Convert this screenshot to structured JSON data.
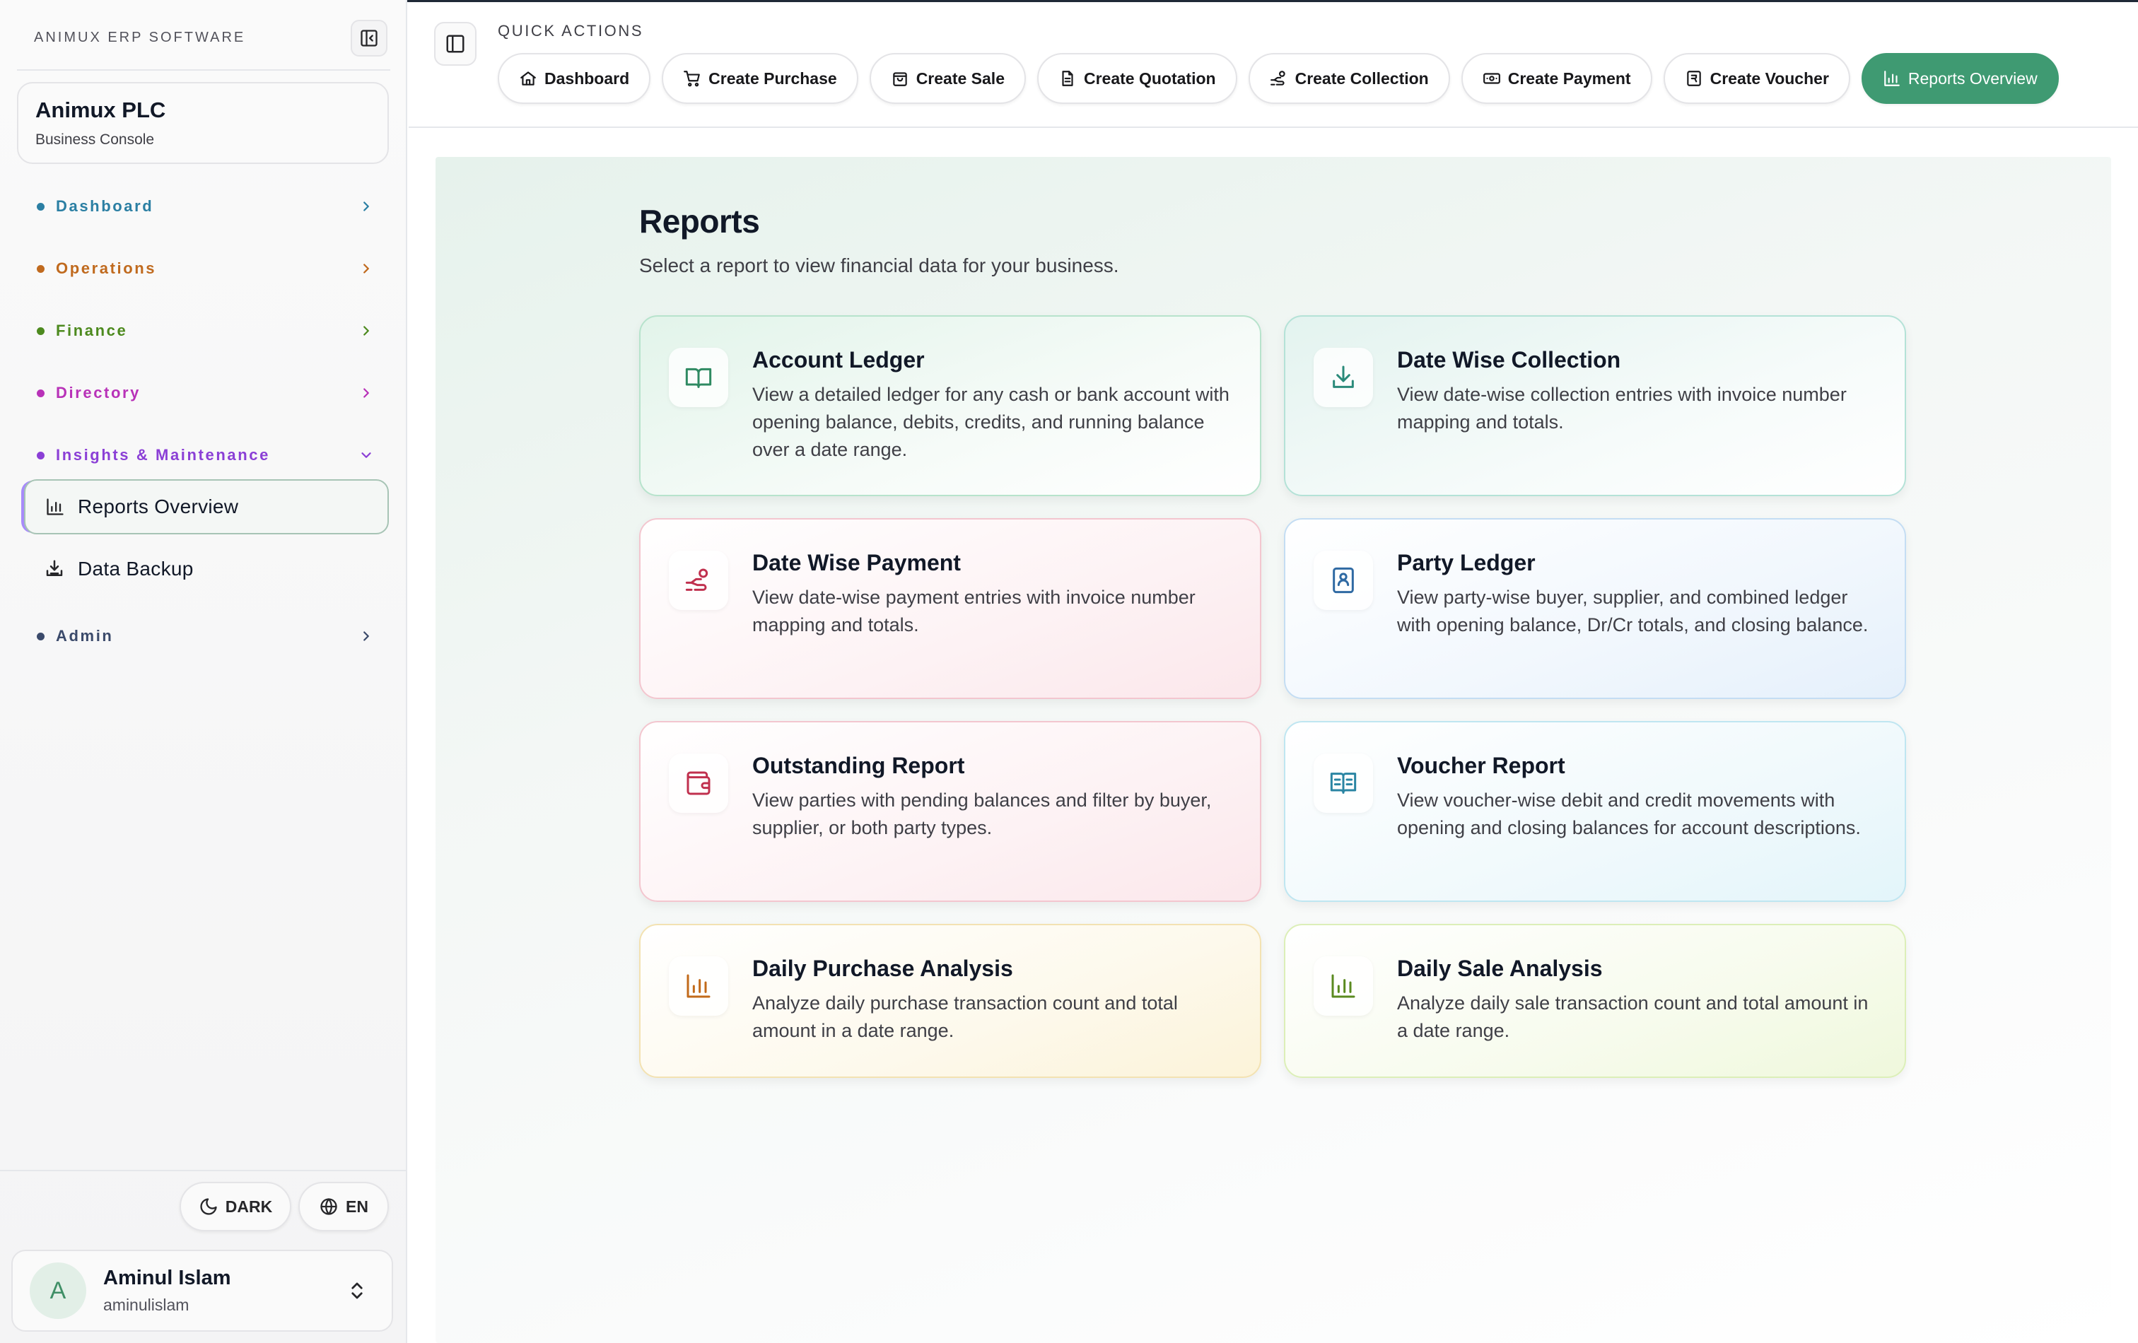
{
  "app": {
    "brand": "ANIMUX ERP SOFTWARE",
    "org_name": "Animux PLC",
    "org_sub": "Business Console"
  },
  "sidebar": {
    "groups": [
      {
        "label": "Dashboard",
        "color": "#2b7fa3"
      },
      {
        "label": "Operations",
        "color": "#c06a1e"
      },
      {
        "label": "Finance",
        "color": "#4d8a1f"
      },
      {
        "label": "Directory",
        "color": "#b832b8"
      },
      {
        "label": "Insights & Maintenance",
        "color": "#8b3fd6"
      },
      {
        "label": "Admin",
        "color": "#3b4a6b"
      }
    ],
    "sub_items": [
      {
        "label": "Reports Overview",
        "icon": "bar-chart-icon",
        "active": true
      },
      {
        "label": "Data Backup",
        "icon": "download-tray-icon",
        "active": false
      }
    ],
    "theme_label": "DARK",
    "lang_label": "EN",
    "user": {
      "initial": "A",
      "name": "Aminul Islam",
      "handle": "aminulislam"
    }
  },
  "topbar": {
    "quick_actions_label": "QUICK ACTIONS",
    "actions": [
      {
        "label": "Dashboard",
        "icon": "home-icon"
      },
      {
        "label": "Create Purchase",
        "icon": "cart-icon"
      },
      {
        "label": "Create Sale",
        "icon": "bag-icon"
      },
      {
        "label": "Create Quotation",
        "icon": "document-icon"
      },
      {
        "label": "Create Collection",
        "icon": "hand-coins-icon"
      },
      {
        "label": "Create Payment",
        "icon": "banknote-icon"
      },
      {
        "label": "Create Voucher",
        "icon": "voucher-icon"
      },
      {
        "label": "Reports Overview",
        "icon": "bar-chart-icon",
        "active": true
      }
    ],
    "accent": "#3f9a72"
  },
  "main": {
    "title": "Reports",
    "subtitle": "Select a report to view financial data for your business.",
    "cards": [
      {
        "title": "Account Ledger",
        "desc": "View a detailed ledger for any cash or bank account with opening balance, debits, credits, and running balance over a date range.",
        "icon": "book-open-icon",
        "color": "#2f8a62"
      },
      {
        "title": "Date Wise Collection",
        "desc": "View date-wise collection entries with invoice number mapping and totals.",
        "icon": "download-tray-icon",
        "color": "#2a8a7a"
      },
      {
        "title": "Date Wise Payment",
        "desc": "View date-wise payment entries with invoice number mapping and totals.",
        "icon": "hand-coins-icon",
        "color": "#c0304e"
      },
      {
        "title": "Party Ledger",
        "desc": "View party-wise buyer, supplier, and combined ledger with opening balance, Dr/Cr totals, and closing balance.",
        "icon": "contact-book-icon",
        "color": "#2f6aa3"
      },
      {
        "title": "Outstanding Report",
        "desc": "View parties with pending balances and filter by buyer, supplier, or both party types.",
        "icon": "wallet-icon",
        "color": "#c0304e"
      },
      {
        "title": "Voucher Report",
        "desc": "View voucher-wise debit and credit movements with opening and closing balances for account descriptions.",
        "icon": "book-columns-icon",
        "color": "#2a85a3"
      },
      {
        "title": "Daily Purchase Analysis",
        "desc": "Analyze daily purchase transaction count and total amount in a date range.",
        "icon": "bar-chart-icon",
        "color": "#c26a1a"
      },
      {
        "title": "Daily Sale Analysis",
        "desc": "Analyze daily sale transaction count and total amount in a date range.",
        "icon": "bar-chart-icon",
        "color": "#5a8a1f"
      }
    ]
  }
}
